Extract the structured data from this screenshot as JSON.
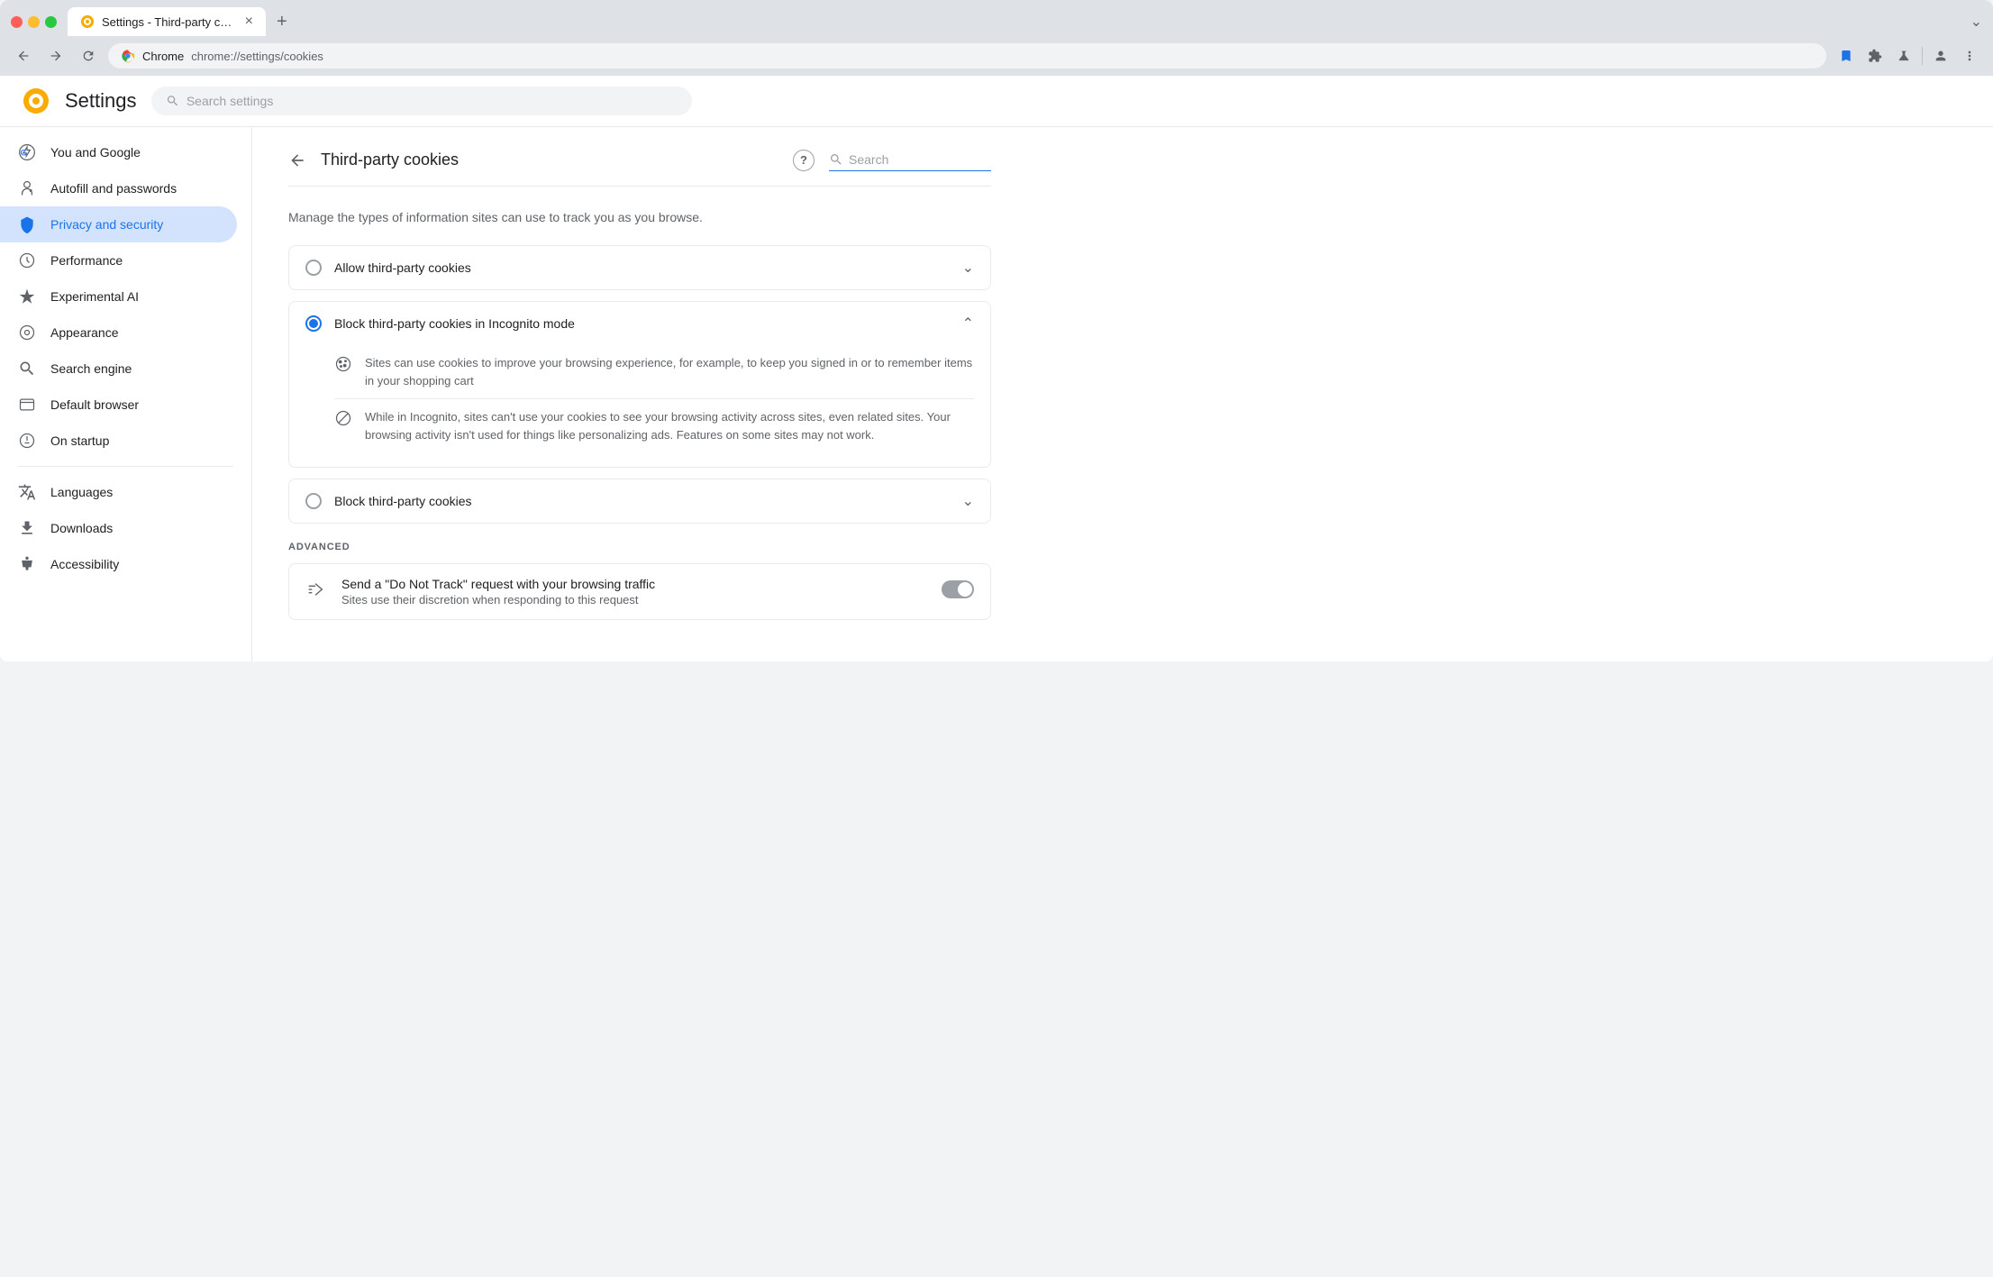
{
  "browser": {
    "tab_title": "Settings - Third-party cookie",
    "tab_close": "×",
    "tab_new": "+",
    "address": "chrome://settings/cookies",
    "address_label": "Chrome",
    "tab_overflow": "⌄"
  },
  "toolbar": {
    "back_title": "Back",
    "forward_title": "Forward",
    "reload_title": "Reload",
    "bookmark_title": "Bookmark",
    "extensions_title": "Extensions",
    "labs_title": "Chrome Labs",
    "profile_title": "Profile",
    "menu_title": "Menu"
  },
  "settings": {
    "logo_alt": "Settings",
    "title": "Settings",
    "search_placeholder": "Search settings"
  },
  "sidebar": {
    "items": [
      {
        "id": "you-and-google",
        "label": "You and Google",
        "icon": "google"
      },
      {
        "id": "autofill-and-passwords",
        "label": "Autofill and passwords",
        "icon": "autofill"
      },
      {
        "id": "privacy-and-security",
        "label": "Privacy and security",
        "icon": "shield",
        "active": true
      },
      {
        "id": "performance",
        "label": "Performance",
        "icon": "performance"
      },
      {
        "id": "experimental-ai",
        "label": "Experimental AI",
        "icon": "ai"
      },
      {
        "id": "appearance",
        "label": "Appearance",
        "icon": "appearance"
      },
      {
        "id": "search-engine",
        "label": "Search engine",
        "icon": "search"
      },
      {
        "id": "default-browser",
        "label": "Default browser",
        "icon": "browser"
      },
      {
        "id": "on-startup",
        "label": "On startup",
        "icon": "startup"
      }
    ],
    "items2": [
      {
        "id": "languages",
        "label": "Languages",
        "icon": "languages"
      },
      {
        "id": "downloads",
        "label": "Downloads",
        "icon": "downloads"
      },
      {
        "id": "accessibility",
        "label": "Accessibility",
        "icon": "accessibility"
      }
    ]
  },
  "page": {
    "back_label": "←",
    "title": "Third-party cookies",
    "help_label": "?",
    "search_placeholder": "Search",
    "description": "Manage the types of information sites can use to track you as you browse."
  },
  "options": [
    {
      "id": "allow",
      "label": "Allow third-party cookies",
      "selected": false,
      "expanded": false
    },
    {
      "id": "block-incognito",
      "label": "Block third-party cookies in Incognito mode",
      "selected": true,
      "expanded": true,
      "items": [
        {
          "icon": "cookie",
          "text": "Sites can use cookies to improve your browsing experience, for example, to keep you signed in or to remember items in your shopping cart"
        },
        {
          "icon": "block",
          "text": "While in Incognito, sites can't use your cookies to see your browsing activity across sites, even related sites. Your browsing activity isn't used for things like personalizing ads. Features on some sites may not work."
        }
      ]
    },
    {
      "id": "block-all",
      "label": "Block third-party cookies",
      "selected": false,
      "expanded": false
    }
  ],
  "advanced": {
    "label": "Advanced",
    "toggle_row": {
      "main_text": "Send a \"Do Not Track\" request with your browsing traffic",
      "sub_text": "Sites use their discretion when responding to this request",
      "enabled": false
    }
  }
}
